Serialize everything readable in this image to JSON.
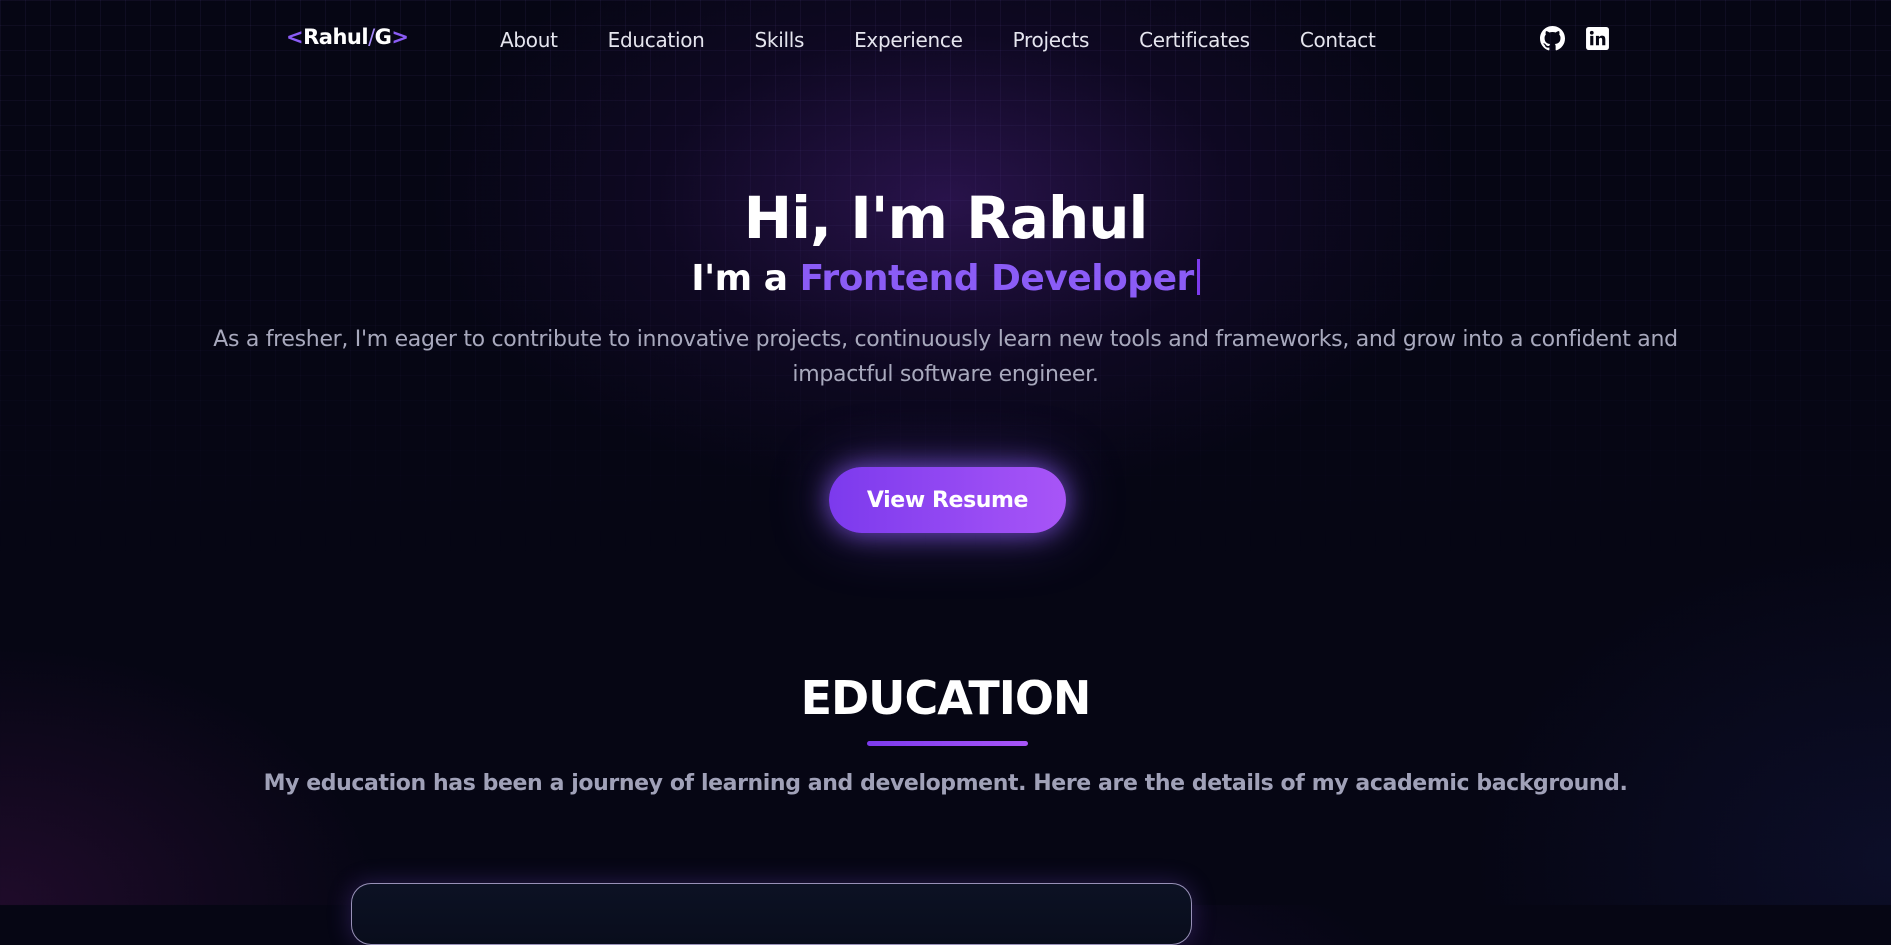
{
  "nav": {
    "logo": {
      "open_bracket": "<",
      "name": "Rahul",
      "slash": "/",
      "initial": "G",
      "close_bracket": ">"
    },
    "links": [
      {
        "label": "About"
      },
      {
        "label": "Education"
      },
      {
        "label": "Skills"
      },
      {
        "label": "Experience"
      },
      {
        "label": "Projects"
      },
      {
        "label": "Certificates"
      },
      {
        "label": "Contact"
      }
    ],
    "social_icons": [
      "github-icon",
      "linkedin-icon"
    ]
  },
  "hero": {
    "greeting": "Hi, I'm Rahul",
    "role_prefix": "I'm a",
    "role": "Frontend Developer",
    "description": "As a fresher, I'm eager to contribute to innovative projects, continuously learn new tools and frameworks, and grow into a confident and impactful software engineer.",
    "resume_button": "View Resume"
  },
  "education": {
    "title": "EDUCATION",
    "description": "My education has been a journey of learning and development. Here are the details of my academic background."
  },
  "colors": {
    "background": "#060614",
    "accent": "#8b5cf6",
    "accent_light": "#a855f7",
    "text": "#ffffff",
    "muted_text": "#a8a9bd"
  }
}
